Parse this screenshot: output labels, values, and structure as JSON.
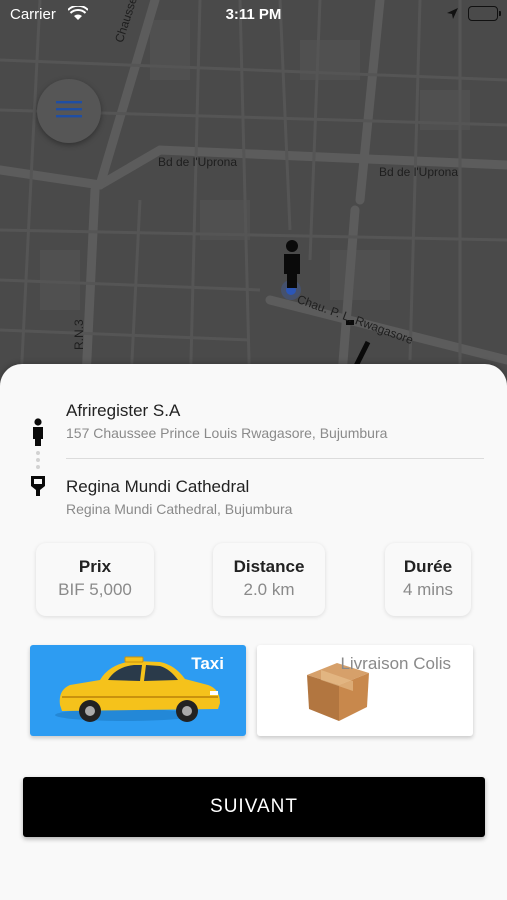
{
  "status_bar": {
    "carrier": "Carrier",
    "time": "3:11 PM"
  },
  "map": {
    "labels": {
      "chaussee": "Chaussee du",
      "uprona_left": "Bd de l'Uprona",
      "uprona_right": "Bd de l'Uprona",
      "rn3": "R.N.3",
      "rwagasore": "Chau. P. L. Rwagasore"
    },
    "icons": [
      "hamburger-menu-icon",
      "person-location-icon"
    ],
    "colors": {
      "background": "#4a4a4a",
      "roads": "#5a5a5a",
      "menu_icon": "#1f4ea3"
    }
  },
  "trip": {
    "origin": {
      "title": "Afriregister S.A",
      "address": "157 Chaussee Prince Louis Rwagasore, Bujumbura"
    },
    "destination": {
      "title": "Regina Mundi Cathedral",
      "address": "Regina Mundi Cathedral, Bujumbura"
    }
  },
  "stats": {
    "price": {
      "label": "Prix",
      "value": "BIF 5,000"
    },
    "distance": {
      "label": "Distance",
      "value": "2.0 km"
    },
    "duration": {
      "label": "Durée",
      "value": "4 mins"
    }
  },
  "services": {
    "taxi": {
      "label": "Taxi",
      "selected": true,
      "color": "#2d9cf2"
    },
    "colis": {
      "label": "Livraison Colis",
      "selected": false
    }
  },
  "actions": {
    "next_label": "SUIVANT"
  }
}
